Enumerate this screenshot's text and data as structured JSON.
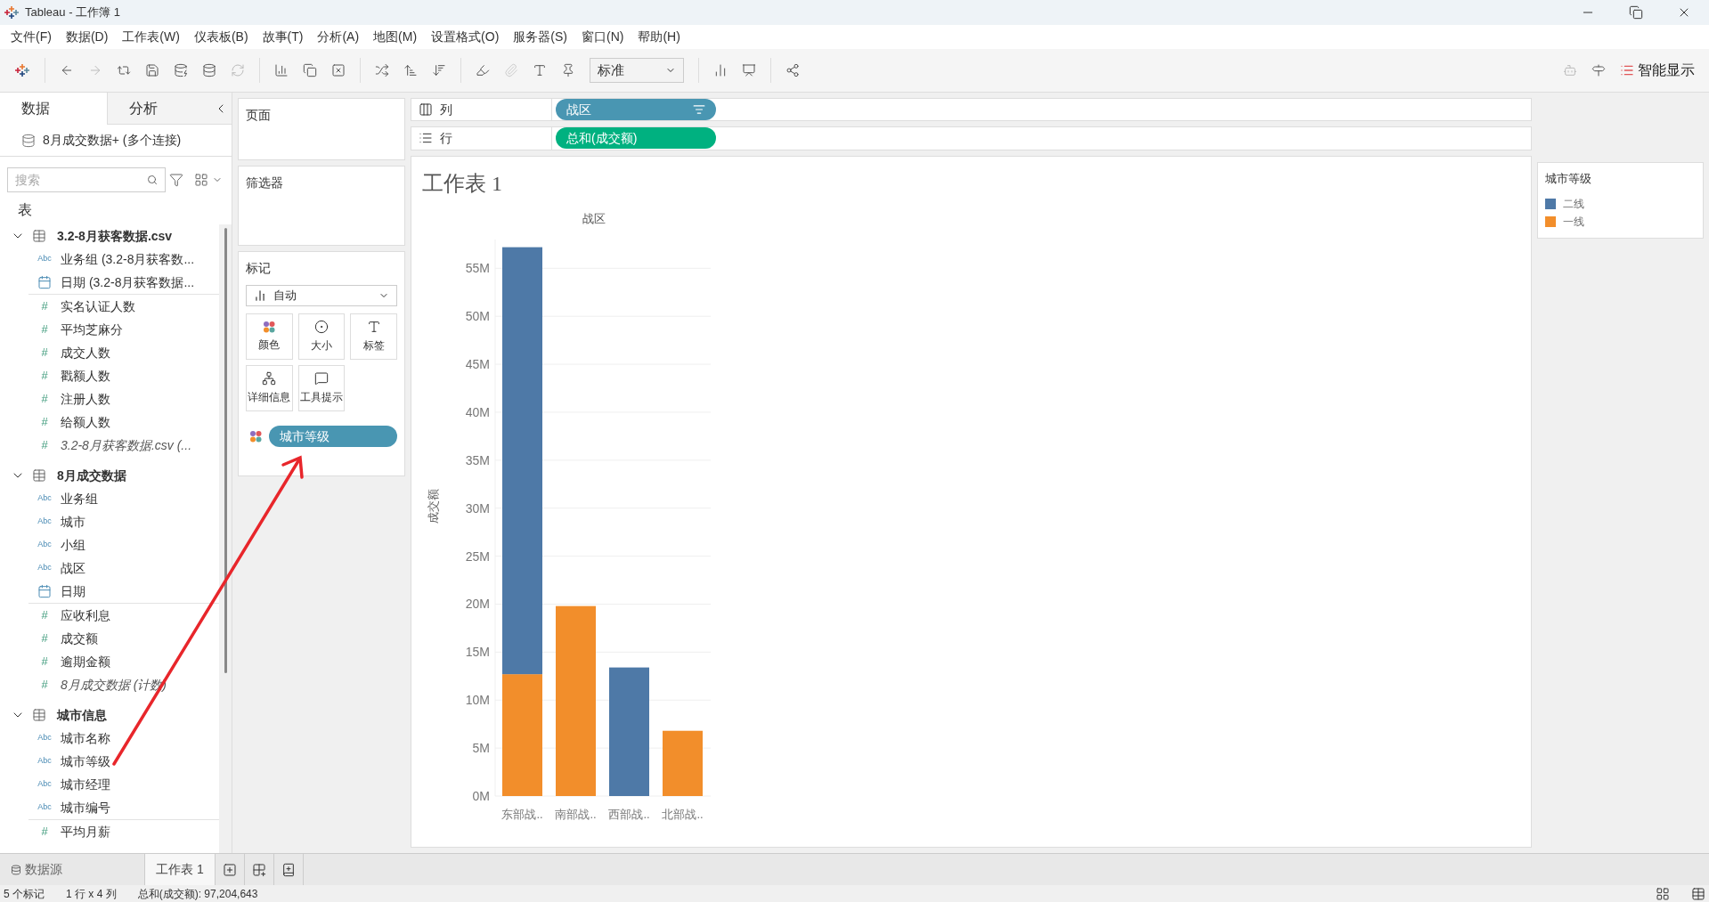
{
  "window": {
    "title": "Tableau - 工作簿 1"
  },
  "menu": [
    "文件(F)",
    "数据(D)",
    "工作表(W)",
    "仪表板(B)",
    "故事(T)",
    "分析(A)",
    "地图(M)",
    "设置格式(O)",
    "服务器(S)",
    "窗口(N)",
    "帮助(H)"
  ],
  "toolbar": {
    "fit_select": "标准",
    "show_me": "智能显示"
  },
  "left_tabs": [
    {
      "label": "数据",
      "selected": true
    },
    {
      "label": "分析",
      "selected": false
    }
  ],
  "connection": "8月成交数据+ (多个连接)",
  "search": {
    "placeholder": "搜索"
  },
  "tables_heading": "表",
  "tables": [
    {
      "name": "3.2-8月获客数据.csv",
      "fields": [
        {
          "name": "业务组 (3.2-8月获客数...",
          "kind": "string",
          "glyph": "Abc"
        },
        {
          "name": "日期 (3.2-8月获客数据...",
          "kind": "date"
        },
        {
          "name": "实名认证人数",
          "kind": "number",
          "glyph": "#"
        },
        {
          "name": "平均芝麻分",
          "kind": "number",
          "glyph": "#"
        },
        {
          "name": "成交人数",
          "kind": "number",
          "glyph": "#"
        },
        {
          "name": "戳额人数",
          "kind": "number",
          "glyph": "#"
        },
        {
          "name": "注册人数",
          "kind": "number",
          "glyph": "#"
        },
        {
          "name": "给额人数",
          "kind": "number",
          "glyph": "#"
        },
        {
          "name": "3.2-8月获客数据.csv (...",
          "kind": "count",
          "glyph": "#"
        }
      ]
    },
    {
      "name": "8月成交数据",
      "fields": [
        {
          "name": "业务组",
          "kind": "string",
          "glyph": "Abc"
        },
        {
          "name": "城市",
          "kind": "string",
          "glyph": "Abc"
        },
        {
          "name": "小组",
          "kind": "string",
          "glyph": "Abc"
        },
        {
          "name": "战区",
          "kind": "string",
          "glyph": "Abc"
        },
        {
          "name": "日期",
          "kind": "date"
        },
        {
          "name": "应收利息",
          "kind": "number",
          "glyph": "#"
        },
        {
          "name": "成交额",
          "kind": "number",
          "glyph": "#"
        },
        {
          "name": "逾期金额",
          "kind": "number",
          "glyph": "#"
        },
        {
          "name": "8月成交数据 (计数)",
          "kind": "count",
          "glyph": "#"
        }
      ]
    },
    {
      "name": "城市信息",
      "fields": [
        {
          "name": "城市名称",
          "kind": "string",
          "glyph": "Abc"
        },
        {
          "name": "城市等级",
          "kind": "string",
          "glyph": "Abc"
        },
        {
          "name": "城市经理",
          "kind": "string",
          "glyph": "Abc"
        },
        {
          "name": "城市编号",
          "kind": "string",
          "glyph": "Abc"
        },
        {
          "name": "平均月薪",
          "kind": "number",
          "glyph": "#"
        }
      ]
    }
  ],
  "cards": {
    "pages": "页面",
    "filters": "筛选器",
    "marks": {
      "title": "标记",
      "mark_type": "自动",
      "buttons": [
        {
          "label": "颜色",
          "kind": "color"
        },
        {
          "label": "大小",
          "kind": "size"
        },
        {
          "label": "标签",
          "kind": "label"
        },
        {
          "label": "详细信息",
          "kind": "detail"
        },
        {
          "label": "工具提示",
          "kind": "tooltip"
        }
      ],
      "pills": [
        {
          "label": "城市等级",
          "kind": "color"
        }
      ]
    }
  },
  "shelves": [
    {
      "label": "列",
      "kind": "columns",
      "pill": {
        "label": "战区",
        "kind": "dimension",
        "sorted": true
      }
    },
    {
      "label": "行",
      "kind": "rows",
      "pill": {
        "label": "总和(成交额)",
        "kind": "measure",
        "sorted": false
      }
    }
  ],
  "sheet": {
    "title": "工作表 1",
    "chart_data": {
      "type": "bar",
      "stacked": true,
      "grid": true,
      "xlabel": "战区",
      "ylabel": "成交额",
      "categories": [
        "东部战..",
        "南部战..",
        "西部战..",
        "北部战.."
      ],
      "series": [
        {
          "name": "一线",
          "color": "#f28e2b",
          "values": [
            12700000,
            19800000,
            null,
            6800000
          ]
        },
        {
          "name": "二线",
          "color": "#4e79a7",
          "values": [
            44500000,
            null,
            13400000,
            null
          ]
        }
      ],
      "ylim": [
        0,
        58000000
      ],
      "yticks": [
        {
          "value": 0,
          "label": "0M"
        },
        {
          "value": 5000000,
          "label": "5M"
        },
        {
          "value": 10000000,
          "label": "10M"
        },
        {
          "value": 15000000,
          "label": "15M"
        },
        {
          "value": 20000000,
          "label": "20M"
        },
        {
          "value": 25000000,
          "label": "25M"
        },
        {
          "value": 30000000,
          "label": "30M"
        },
        {
          "value": 35000000,
          "label": "35M"
        },
        {
          "value": 40000000,
          "label": "40M"
        },
        {
          "value": 45000000,
          "label": "45M"
        },
        {
          "value": 50000000,
          "label": "50M"
        },
        {
          "value": 55000000,
          "label": "55M"
        }
      ]
    }
  },
  "legend": {
    "title": "城市等级"
  },
  "bottom_tabs": [
    {
      "label": "数据源",
      "kind": "datasource",
      "selected": false
    },
    {
      "label": "工作表 1",
      "kind": "sheet",
      "selected": true
    }
  ],
  "status": [
    "5 个标记",
    "1 行 x 4 列",
    "总和(成交额): 97,204,643"
  ]
}
